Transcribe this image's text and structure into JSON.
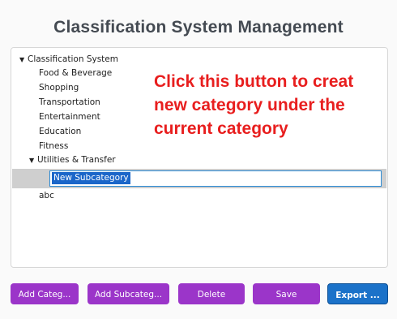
{
  "window": {
    "title": "Classification System Management"
  },
  "tree": {
    "root_label": "Classification System",
    "items": [
      "Food & Beverage",
      "Shopping",
      "Transportation",
      "Entertainment",
      "Education",
      "Fitness"
    ],
    "expanded_item": "Utilities & Transfer",
    "editing_value": "New Subcategory",
    "trailing_item": "abc"
  },
  "annotation": {
    "text": "Click this button to creat\nnew category under the\ncurrent category",
    "color": "#e81e1e"
  },
  "toolbar": {
    "add_category_label": "Add Categ...",
    "add_subcategory_label": "Add Subcateg...",
    "delete_label": "Delete",
    "save_label": "Save",
    "export_label": "Export ..."
  },
  "colors": {
    "button_purple": "#9b35c9",
    "button_blue": "#1b72c9",
    "selection": "#1b66c9"
  }
}
